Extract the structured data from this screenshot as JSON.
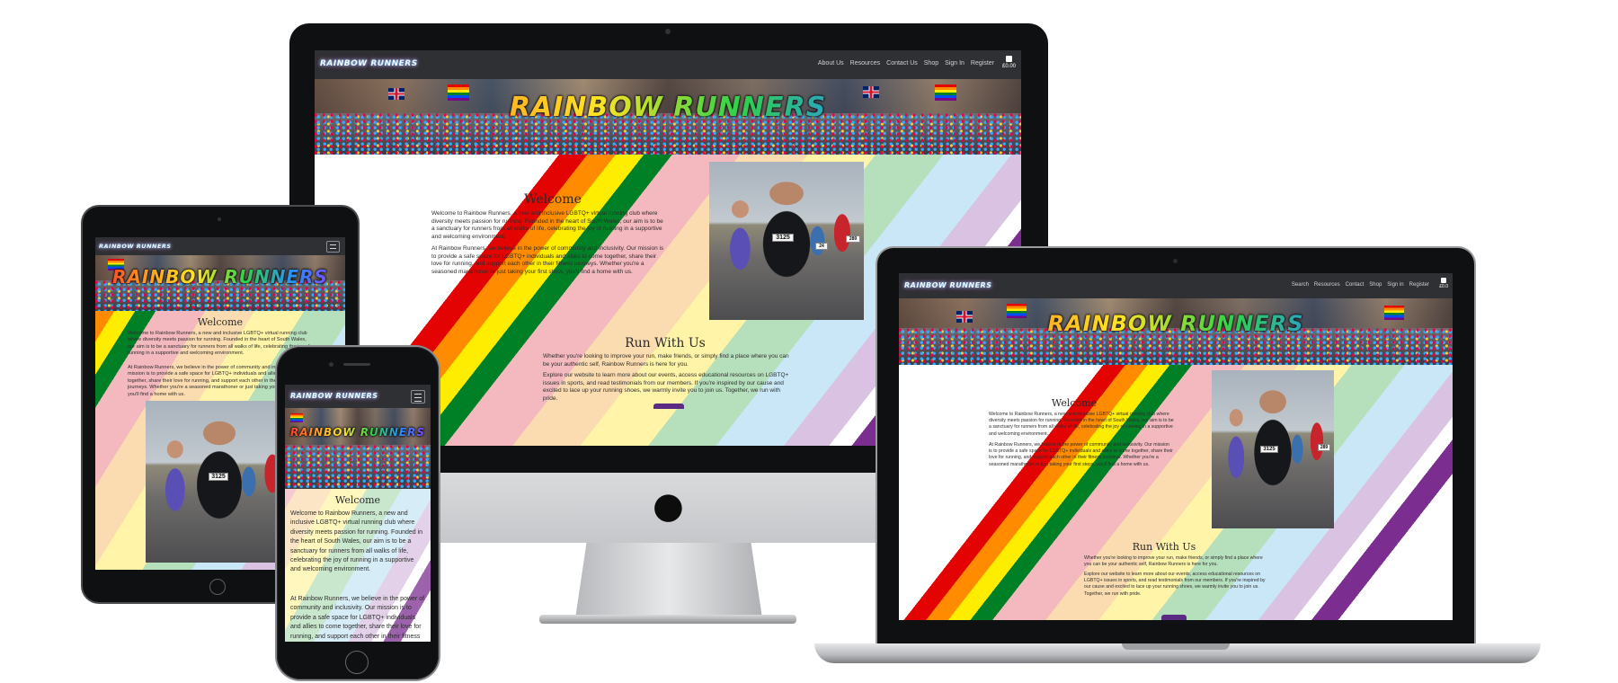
{
  "site": {
    "logo": "RAINBOW RUNNERS",
    "hero_title": "RAINBOW RUNNERS",
    "nav": [
      "About Us",
      "Resources",
      "Contact Us",
      "Shop",
      "Sign In",
      "Register"
    ],
    "nav_laptop": [
      "Search",
      "Resources",
      "Contact",
      "Shop",
      "Sign in",
      "Register"
    ],
    "cart_total": "£0.00",
    "cart_total_laptop": "£0.0",
    "welcome_heading": "Welcome",
    "welcome_p1": "Welcome to Rainbow Runners, a new and inclusive LGBTQ+ virtual running club where diversity meets passion for running. Founded in the heart of South Wales, our aim is to be a sanctuary for runners from all walks of life, celebrating the joy of running in a supportive and welcoming environment.",
    "welcome_p2": "At Rainbow Runners, we believe in the power of community and inclusivity. Our mission is to provide a safe space for LGBTQ+ individuals and allies to come together, share their love for running, and support each other in their fitness journeys. Whether you're a seasoned marathoner or just taking your first steps, you'll find a home with us.",
    "run_heading": "Run With Us",
    "run_p1": "Whether you're looking to improve your run, make friends, or simply find a place where you can be your authentic self, Rainbow Runners is here for you.",
    "run_p2": "Explore our website to learn more about our events, access educational resources on LGBTQ+ issues in sports, and read testimonials from our members. If you're inspired by our cause and excited to lace up your running shoes, we warmly invite you to join us. Together, we run with pride.",
    "photo_bib": "3125",
    "photo_bib2": "24",
    "photo_bib3": "289"
  },
  "colors": {
    "nav_bg": "#2e3033",
    "accent": "#5b2a82",
    "pride": [
      "#e40303",
      "#ff8c00",
      "#ffed00",
      "#008026",
      "#004dff",
      "#750787"
    ]
  },
  "icons": [
    "shopping-bag-icon",
    "hamburger-menu-icon",
    "apple-logo-icon",
    "camera-icon",
    "home-button-icon"
  ]
}
